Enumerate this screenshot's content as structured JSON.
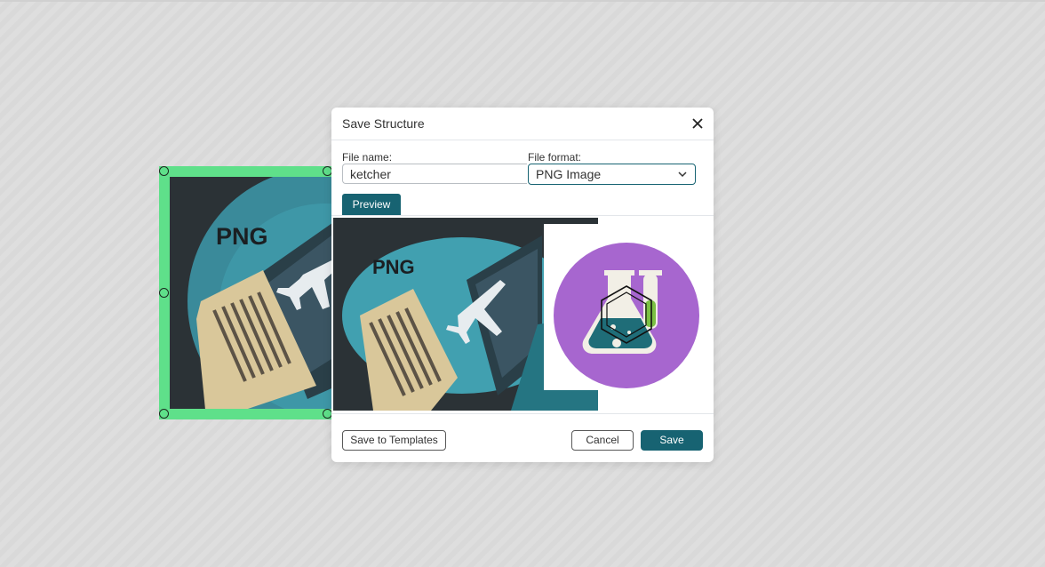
{
  "canvas_image": {
    "text": "PNG"
  },
  "dialog": {
    "title": "Save Structure",
    "close_icon": "close-icon",
    "file_name_label": "File name:",
    "file_name_value": "ketcher",
    "file_format_label": "File format:",
    "file_format_value": "PNG Image",
    "preview_tab": "Preview",
    "preview_png_text": "PNG",
    "save_templates_label": "Save to Templates",
    "cancel_label": "Cancel",
    "save_label": "Save"
  },
  "colors": {
    "accent": "#176372",
    "selection": "#5fe08a",
    "flask_circle": "#a766cf"
  }
}
